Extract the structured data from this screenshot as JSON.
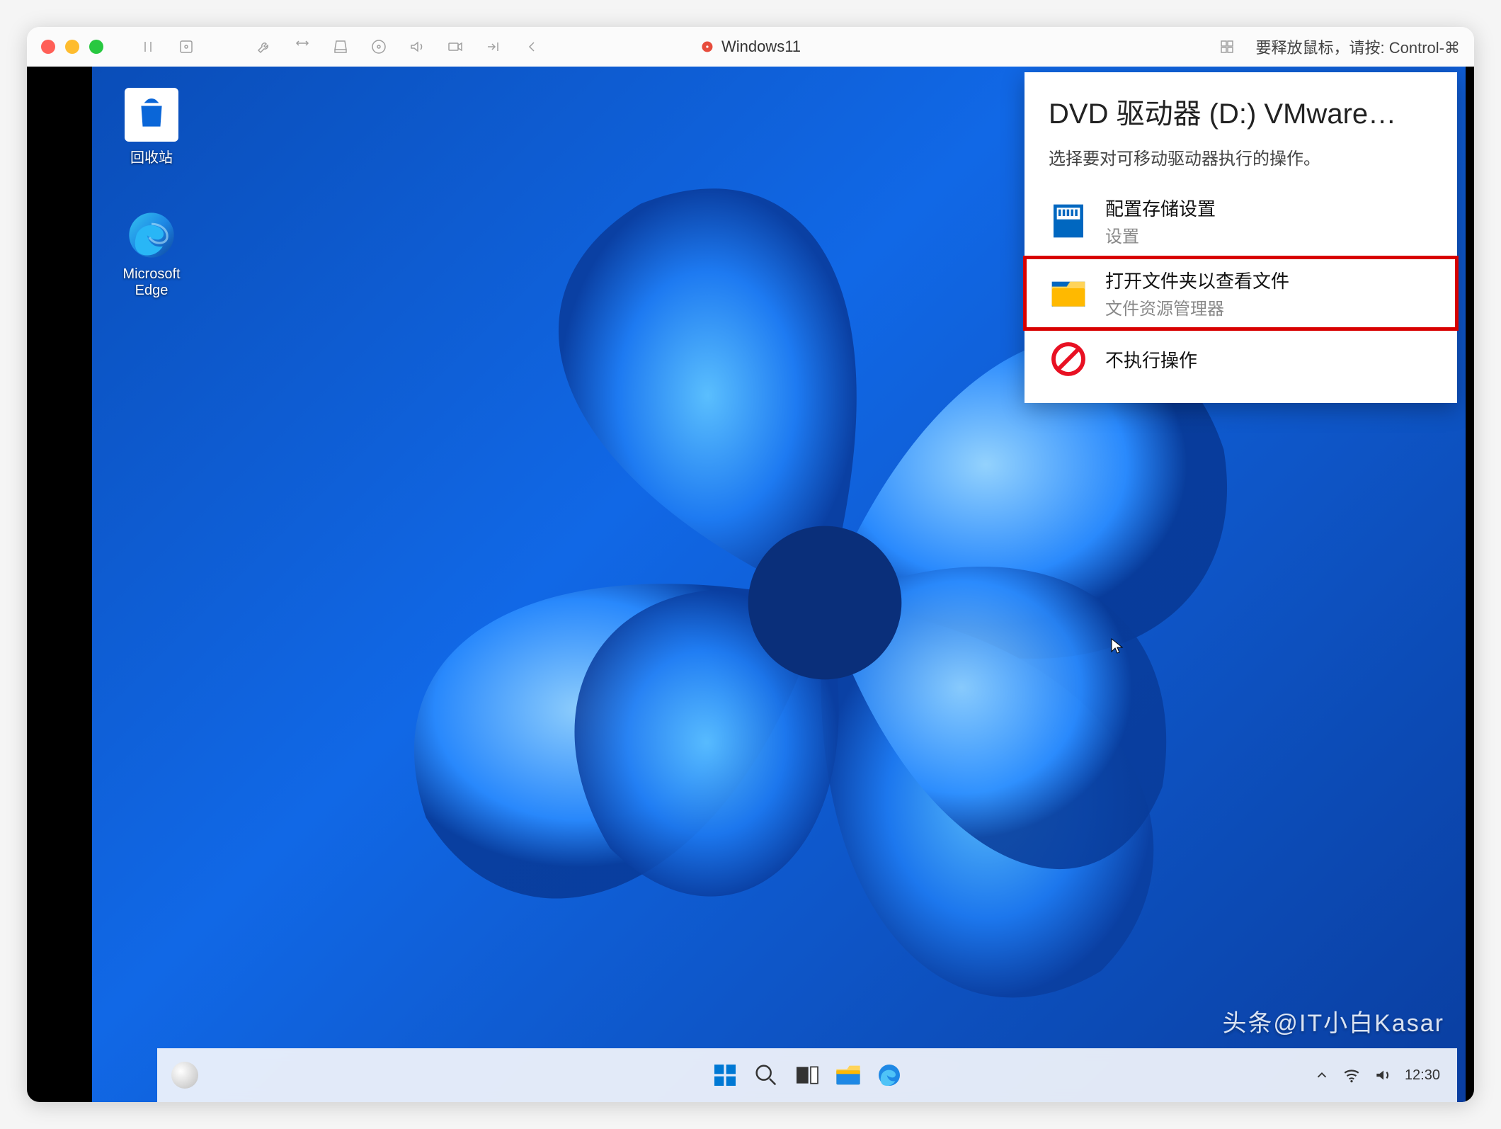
{
  "titlebar": {
    "vm_name": "Windows11",
    "release_hint": "要释放鼠标，请按: Control-⌘"
  },
  "desktop": {
    "recycle_label": "回收站",
    "edge_label_1": "Microsoft",
    "edge_label_2": "Edge"
  },
  "autoplay": {
    "title": "DVD 驱动器 (D:) VMware…",
    "subtitle": "选择要对可移动驱动器执行的操作。",
    "items": [
      {
        "title": "配置存储设置",
        "sub": "设置"
      },
      {
        "title": "打开文件夹以查看文件",
        "sub": "文件资源管理器"
      },
      {
        "title": "不执行操作",
        "sub": ""
      }
    ]
  },
  "systray": {
    "time": "12:30"
  },
  "watermark": "头条@IT小白Kasar"
}
